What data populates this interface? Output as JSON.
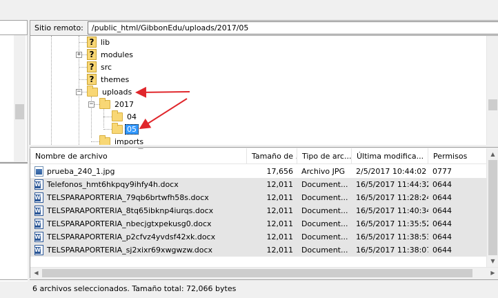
{
  "remote": {
    "path_label": "Sitio remoto:",
    "path_value": "/public_html/GibbonEdu/uploads/2017/05"
  },
  "tree": {
    "nodes": [
      {
        "label": "lib",
        "icon": "question-folder-icon",
        "expander": ""
      },
      {
        "label": "modules",
        "icon": "question-folder-icon",
        "expander": "+"
      },
      {
        "label": "src",
        "icon": "question-folder-icon",
        "expander": ""
      },
      {
        "label": "themes",
        "icon": "question-folder-icon",
        "expander": ""
      },
      {
        "label": "uploads",
        "icon": "folder-icon",
        "expander": "−"
      },
      {
        "label": "2017",
        "icon": "folder-icon",
        "expander": "−"
      },
      {
        "label": "04",
        "icon": "folder-icon",
        "expander": ""
      },
      {
        "label": "05",
        "icon": "folder-icon",
        "expander": "",
        "selected": true
      },
      {
        "label": "imports",
        "icon": "folder-icon",
        "expander": ""
      }
    ]
  },
  "filelist": {
    "headers": {
      "name": "Nombre de archivo",
      "size": "Tamaño de ...",
      "type": "Tipo de arc...",
      "modified": "Última modifica...",
      "perms": "Permisos"
    },
    "rows": [
      {
        "name": "prueba_240_1.jpg",
        "size": "17,656",
        "type": "Archivo JPG",
        "modified": "2/5/2017 10:44:02",
        "perms": "0777",
        "icon": "image-file-icon",
        "selected": false
      },
      {
        "name": "Telefonos_hmt6hkpqy9ihfy4h.docx",
        "size": "12,011",
        "type": "Document...",
        "modified": "16/5/2017 11:44:32",
        "perms": "0644",
        "icon": "word-document-icon",
        "selected": true
      },
      {
        "name": "TELSPARAPORTERIA_79qb6brtwfh58s.docx",
        "size": "12,011",
        "type": "Document...",
        "modified": "16/5/2017 11:28:24",
        "perms": "0644",
        "icon": "word-document-icon",
        "selected": true
      },
      {
        "name": "TELSPARAPORTERIA_8tq65ibknp4iurqs.docx",
        "size": "12,011",
        "type": "Document...",
        "modified": "16/5/2017 11:40:34",
        "perms": "0644",
        "icon": "word-document-icon",
        "selected": true
      },
      {
        "name": "TELSPARAPORTERIA_nbecjgtxpekusg0.docx",
        "size": "12,011",
        "type": "Document...",
        "modified": "16/5/2017 11:35:52",
        "perms": "0644",
        "icon": "word-document-icon",
        "selected": true
      },
      {
        "name": "TELSPARAPORTERIA_p2cfvz4yvdsf42xk.docx",
        "size": "12,011",
        "type": "Document...",
        "modified": "16/5/2017 11:38:53",
        "perms": "0644",
        "icon": "word-document-icon",
        "selected": true
      },
      {
        "name": "TELSPARAPORTERIA_sj2xixr69xwgwzw.docx",
        "size": "12,011",
        "type": "Document...",
        "modified": "16/5/2017 11:38:07",
        "perms": "0644",
        "icon": "word-document-icon",
        "selected": true
      }
    ]
  },
  "status": {
    "text": "6 archivos seleccionados. Tamaño total: 72,066 bytes"
  },
  "colors": {
    "selection_highlight": "#3399ff",
    "selected_row": "#e5e5e5",
    "annotation_arrow": "#e0262b",
    "folder": "#f8d775"
  }
}
